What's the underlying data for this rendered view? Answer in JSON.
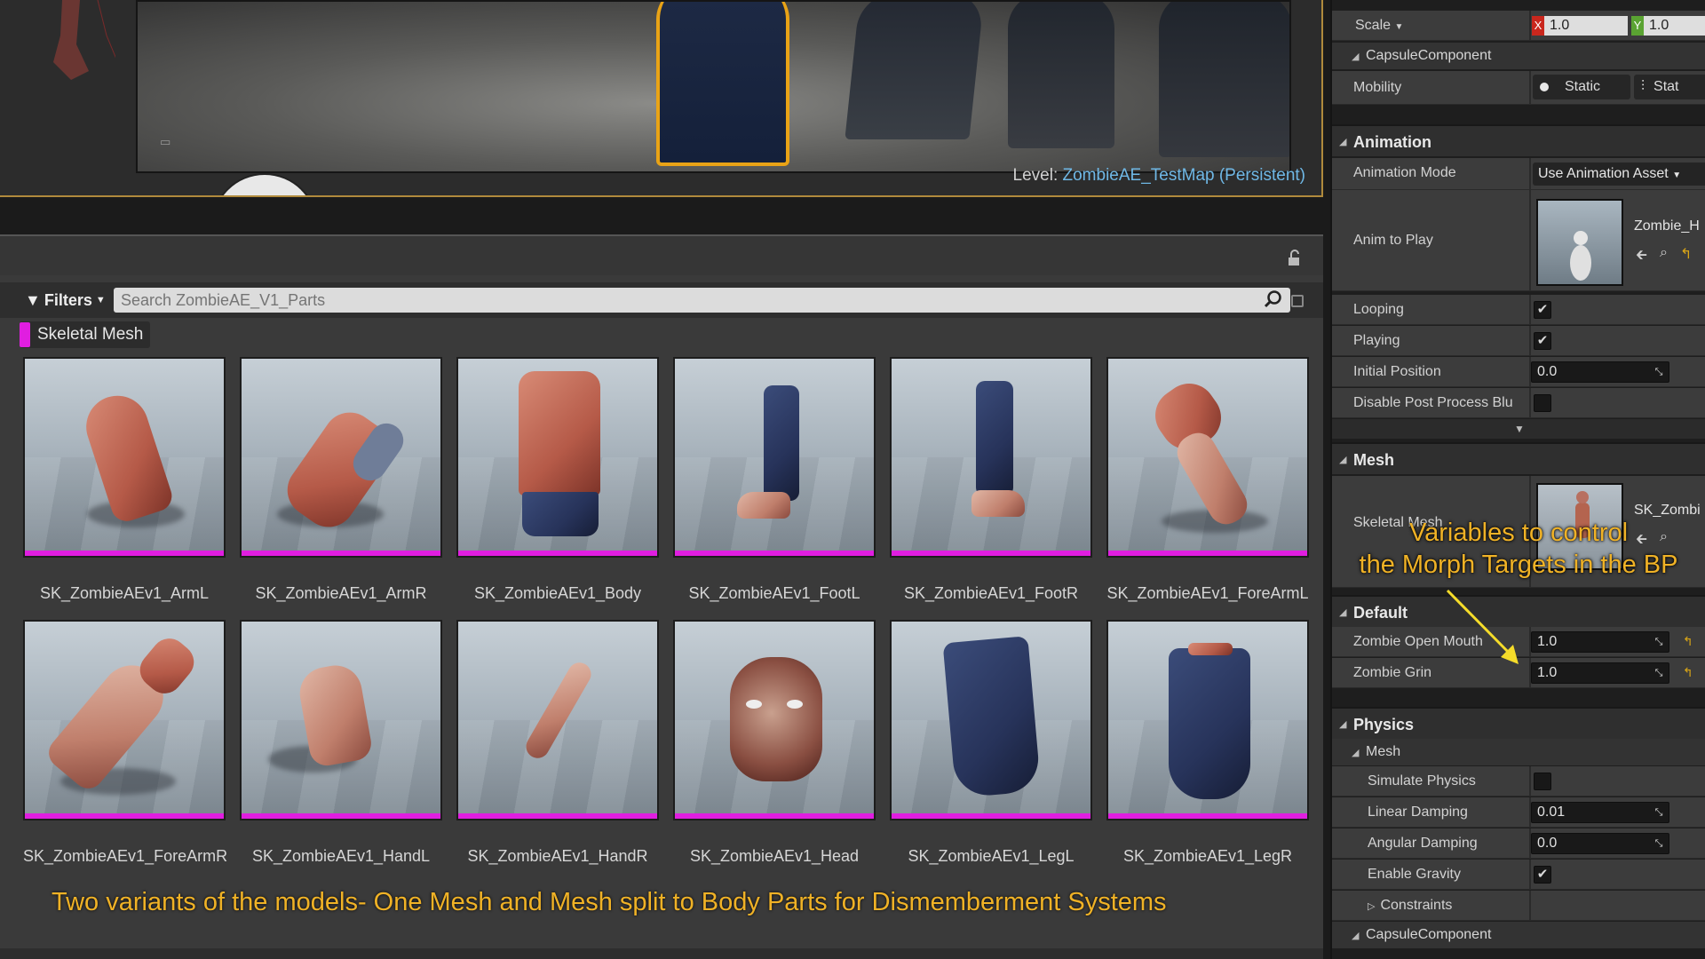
{
  "viewport": {
    "level_prefix": "Level:",
    "level_name": "ZombieAE_TestMap (Persistent)"
  },
  "content_browser": {
    "filters_label": "Filters",
    "search_placeholder": "Search ZombieAE_V1_Parts",
    "active_filter": {
      "label": "Skeletal Mesh",
      "color": "#e01ee0"
    },
    "asset_bar_color": "#e01ee0",
    "assets": [
      {
        "name": "SK_ZombieAEv1_ArmL"
      },
      {
        "name": "SK_ZombieAEv1_ArmR"
      },
      {
        "name": "SK_ZombieAEv1_Body"
      },
      {
        "name": "SK_ZombieAEv1_FootL"
      },
      {
        "name": "SK_ZombieAEv1_FootR"
      },
      {
        "name": "SK_ZombieAEv1_ForeArmL"
      },
      {
        "name": "SK_ZombieAEv1_ForeArmR"
      },
      {
        "name": "SK_ZombieAEv1_HandL"
      },
      {
        "name": "SK_ZombieAEv1_HandR"
      },
      {
        "name": "SK_ZombieAEv1_Head"
      },
      {
        "name": "SK_ZombieAEv1_LegL"
      },
      {
        "name": "SK_ZombieAEv1_LegR"
      }
    ],
    "caption": "Two variants of the models- One Mesh and Mesh split to Body Parts for Dismemberment Systems"
  },
  "details": {
    "scale": {
      "label": "Scale",
      "x_badge": "X",
      "x": "1.0",
      "y_badge": "Y",
      "y": "1.0"
    },
    "capsule_top": {
      "label": "CapsuleComponent"
    },
    "mobility": {
      "label": "Mobility",
      "option1": "Static",
      "option2": "Stat"
    },
    "animation": {
      "header": "Animation",
      "mode_label": "Animation Mode",
      "mode_value": "Use Animation Asset",
      "anim_to_play_label": "Anim to Play",
      "anim_asset_name": "Zombie_H",
      "looping_label": "Looping",
      "looping": true,
      "playing_label": "Playing",
      "playing": true,
      "initial_position_label": "Initial Position",
      "initial_position": "0.0",
      "disable_post_label": "Disable Post Process Blu",
      "disable_post": false
    },
    "mesh": {
      "header": "Mesh",
      "skeletal_mesh_label": "Skeletal Mesh",
      "skeletal_mesh_value": "SK_Zombi"
    },
    "default": {
      "header": "Default",
      "open_mouth_label": "Zombie Open Mouth",
      "open_mouth": "1.0",
      "grin_label": "Zombie Grin",
      "grin": "1.0"
    },
    "physics": {
      "header": "Physics",
      "mesh_sub": "Mesh",
      "simulate_label": "Simulate Physics",
      "simulate": false,
      "linear_damping_label": "Linear Damping",
      "linear_damping": "0.01",
      "angular_damping_label": "Angular Damping",
      "angular_damping": "0.0",
      "gravity_label": "Enable Gravity",
      "gravity": true,
      "constraints_label": "Constraints",
      "capsule_label": "CapsuleComponent"
    },
    "morph_note_line1": "Variables to control",
    "morph_note_line2": "the Morph Targets in the BP"
  }
}
